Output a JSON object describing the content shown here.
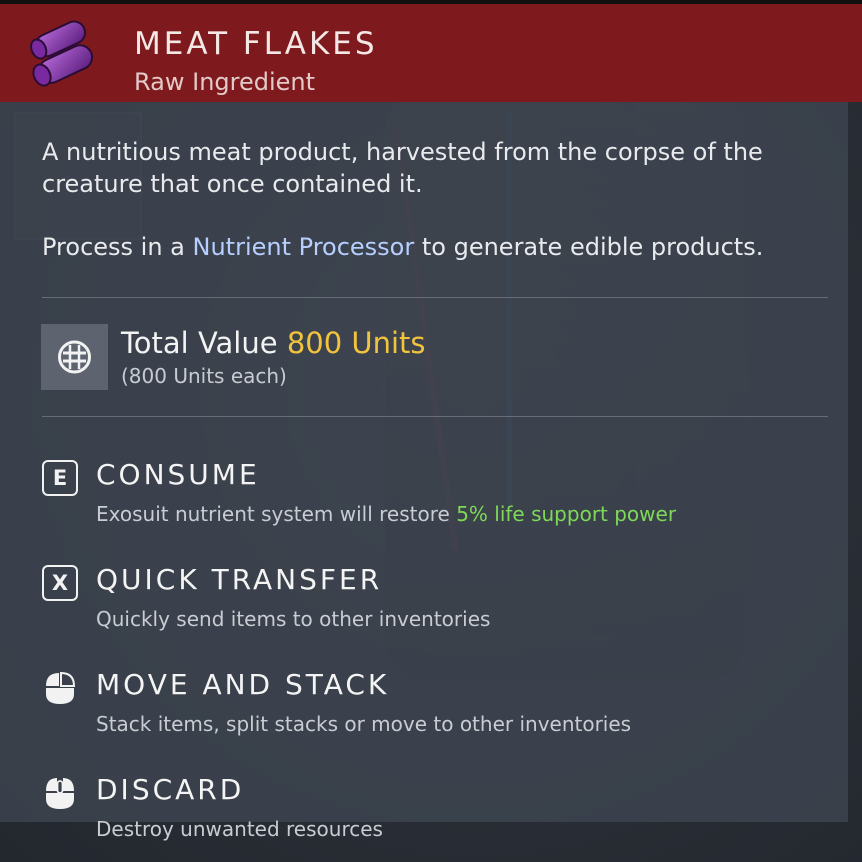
{
  "item": {
    "name": "MEAT FLAKES",
    "type": "Raw Ingredient",
    "description": "A nutritious meat product, harvested from the corpse of the creature that once contained it.",
    "process_prefix": "Process in a ",
    "process_link": "Nutrient Processor",
    "process_suffix": " to generate edible products.",
    "icon": "meat-flakes-icon"
  },
  "value": {
    "label": "Total Value ",
    "amount": "800 Units",
    "each": "(800 Units each)",
    "icon": "units-currency-icon"
  },
  "actions": [
    {
      "key": "E",
      "title": "CONSUME",
      "subtitle_prefix": "Exosuit nutrient system will restore ",
      "subtitle_highlight": "5% life support power",
      "icon": "key-e-icon"
    },
    {
      "key": "X",
      "title": "QUICK TRANSFER",
      "subtitle": "Quickly send items to other inventories",
      "icon": "key-x-icon"
    },
    {
      "title": "MOVE AND STACK",
      "subtitle": "Stack items, split stacks or move to other inventories",
      "icon": "left-mouse-button-icon"
    },
    {
      "title": "DISCARD",
      "subtitle": "Destroy unwanted resources",
      "icon": "middle-mouse-button-icon"
    }
  ],
  "colors": {
    "header": "#7e1a1e",
    "value_amount": "#f2c33c",
    "link": "#b6cfff",
    "highlight": "#7ed957"
  }
}
